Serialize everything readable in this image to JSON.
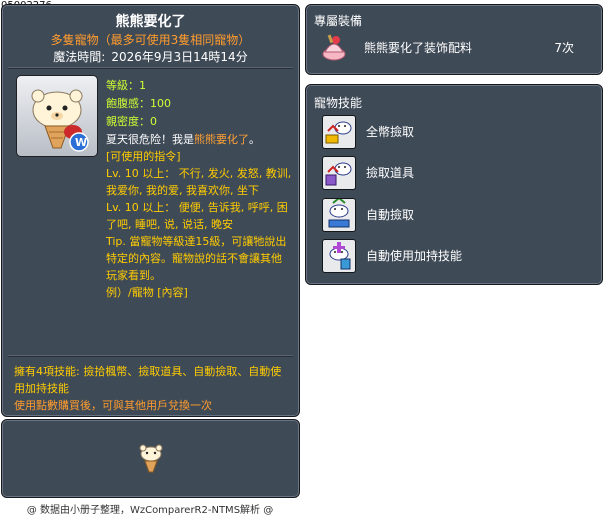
{
  "item_id": "05002276",
  "main": {
    "title": "熊熊要化了",
    "subtitle": "多隻寵物（最多可使用3隻相同寵物）",
    "expire_label": "魔法時間:",
    "expire_value": "2026年9月3日14時14分",
    "stats": {
      "level": "等級：1",
      "fullness": "飽腹感：100",
      "closeness": "親密度：0"
    },
    "description": {
      "intro_plain": "夏天很危险！我是",
      "intro_name": "熊熊要化了",
      "intro_end": "。",
      "commands_header": "[可使用的指令]",
      "cmd1": "Lv. 10 以上： 不行, 发火, 发怒, 教训, 我爱你, 我的爱, 我喜欢你, 坐下",
      "cmd2": "Lv. 10 以上： 便便, 告诉我, 呼呼, 困了吧, 睡吧, 说, 说话, 晚安",
      "tip": "Tip. 當寵物等級達15級，可讓牠說出特定的內容。寵物說的話不會讓其他玩家看到。",
      "example": "例）/寵物 [內容]"
    },
    "skills_summary": "擁有4項技能: 撿拾楓幣、撿取道具、自動撿取、自動使用加持技能",
    "trade_note": "使用點數購買後，可與其他用戶兌換一次"
  },
  "credit": "@ 数据由小册子整理，WzComparerR2-NTMS解析 @",
  "equip": {
    "header": "專屬裝備",
    "item_name": "熊熊要化了装饰配料",
    "item_count": "7次",
    "icon": "cake-topping-icon"
  },
  "pet_skills": {
    "header": "寵物技能",
    "items": [
      {
        "label": "全幣撿取",
        "icon": "pet-money-pickup-icon"
      },
      {
        "label": "撿取道具",
        "icon": "pet-item-pickup-icon"
      },
      {
        "label": "自動撿取",
        "icon": "pet-auto-pickup-icon"
      },
      {
        "label": "自動使用加持技能",
        "icon": "pet-auto-buff-icon"
      }
    ]
  },
  "colors": {
    "panel_bg": "#3f4a57",
    "subtitle_orange": "#ff9c2e",
    "stat_green": "#ccff33",
    "text_amber": "#ffcc00"
  }
}
